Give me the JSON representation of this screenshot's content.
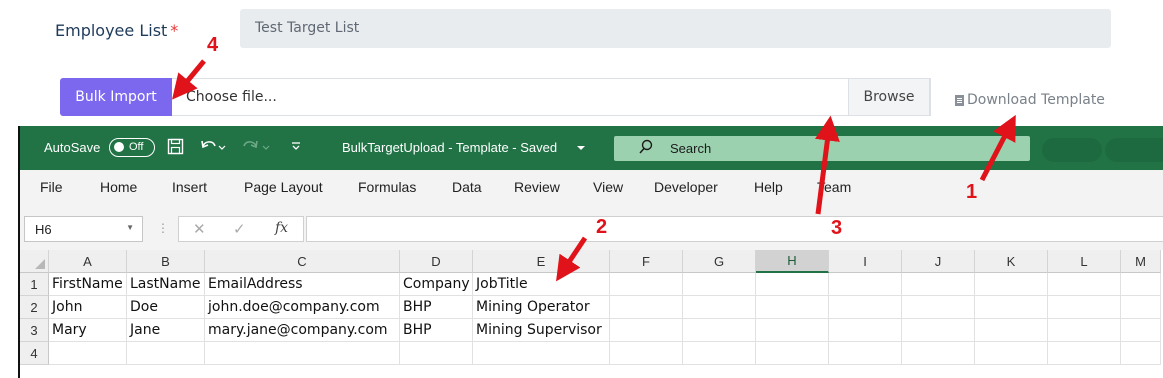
{
  "form": {
    "employee_list_label": "Employee List",
    "required_mark": "*",
    "employee_list_value": "Test Target List",
    "bulk_import_label": "Bulk Import",
    "file_placeholder": "Choose file...",
    "browse_label": "Browse",
    "download_template_label": "Download Template"
  },
  "excel": {
    "autosave_label": "AutoSave",
    "autosave_state": "Off",
    "document_title": "BulkTargetUpload - Template - Saved",
    "search_placeholder": "Search",
    "menu": [
      "File",
      "Home",
      "Insert",
      "Page Layout",
      "Formulas",
      "Data",
      "Review",
      "View",
      "Developer",
      "Help",
      "Team"
    ],
    "name_box": "H6",
    "fx_label": "fx",
    "selected_column": "H",
    "columns": [
      "A",
      "B",
      "C",
      "D",
      "E",
      "F",
      "G",
      "H",
      "I",
      "J",
      "K",
      "L",
      "M"
    ],
    "rows": [
      {
        "num": "1",
        "cells": [
          "FirstName",
          "LastName",
          "EmailAddress",
          "Company",
          "JobTitle"
        ]
      },
      {
        "num": "2",
        "cells": [
          "John",
          "Doe",
          "john.doe@company.com",
          "BHP",
          "Mining Operator"
        ]
      },
      {
        "num": "3",
        "cells": [
          "Mary",
          "Jane",
          "mary.jane@company.com",
          "BHP",
          "Mining Supervisor"
        ]
      },
      {
        "num": "4",
        "cells": [
          "",
          "",
          "",
          "",
          ""
        ]
      }
    ]
  },
  "annotations": {
    "numbers": [
      "1",
      "2",
      "3",
      "4"
    ],
    "color": "#e0121a"
  },
  "colors": {
    "excel_green": "#217346",
    "bulk_button": "#7b68ee",
    "search_box": "#9bd1ae"
  }
}
